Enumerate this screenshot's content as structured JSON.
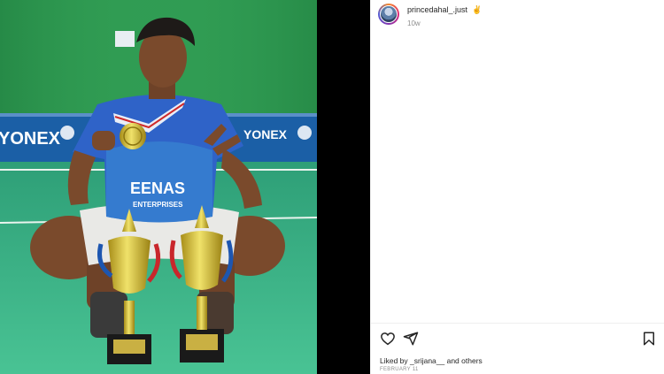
{
  "post": {
    "author": {
      "username": "princedahal_.just",
      "badge_emoji": "✌",
      "avatar_icon": "profile-avatar"
    },
    "time_ago": "10w",
    "media": {
      "jersey_text_line1": "EENAS",
      "jersey_text_line2": "ENTERPRISES",
      "banner_brand": "YONEX"
    },
    "actions": {
      "like_icon": "heart-icon",
      "share_icon": "paper-plane-icon",
      "save_icon": "bookmark-icon"
    },
    "liked_by": "Liked by _srijana__ and others",
    "date": "FEBRUARY 11"
  },
  "colors": {
    "court_green": "#3fbf8e",
    "wall_green": "#2c9a4f",
    "jersey_blue": "#2f63c8",
    "trophy_gold": "#d8c23c"
  }
}
